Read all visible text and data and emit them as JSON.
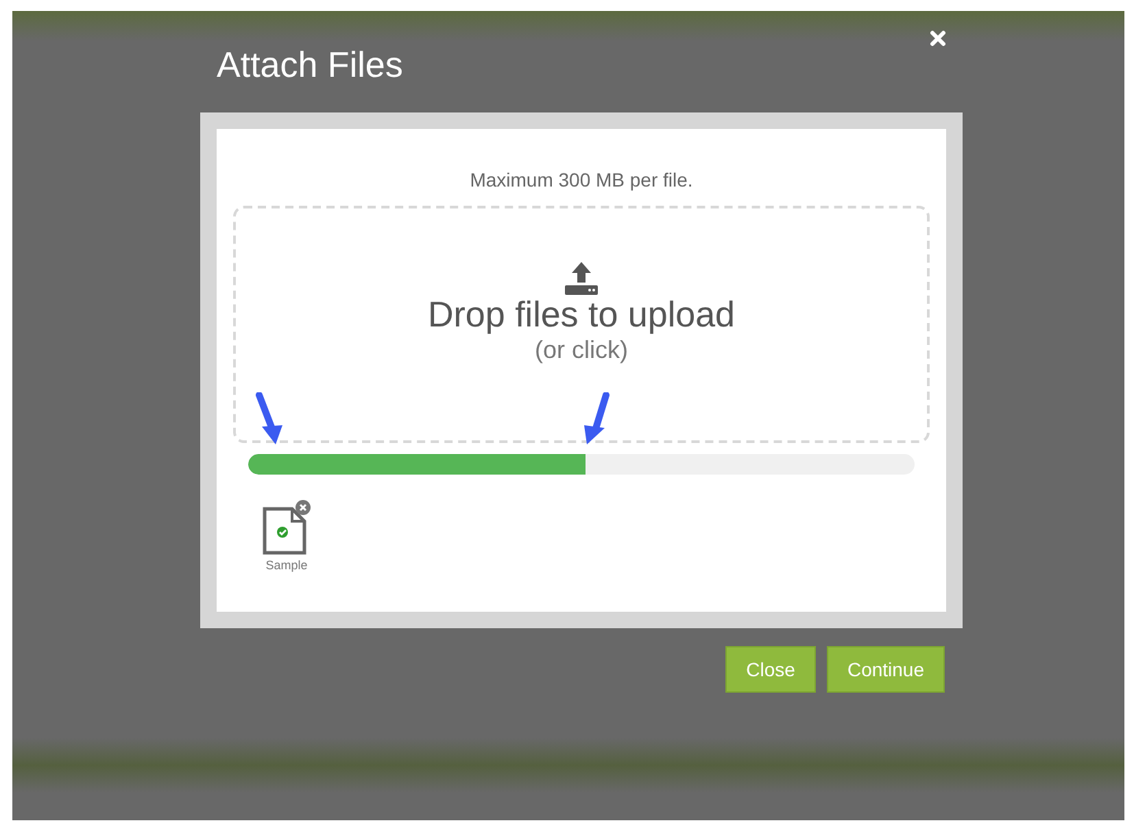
{
  "dialog": {
    "title": "Attach Files"
  },
  "upload": {
    "limit_note": "Maximum 300 MB per file.",
    "drop_label": "Drop files to upload",
    "drop_hint": "(or click)",
    "progress": {
      "level": 0.507
    }
  },
  "files": [
    {
      "name": "Sample",
      "complete": true
    }
  ],
  "buttons": [
    {
      "label": "Close"
    },
    {
      "label": "Continue"
    }
  ]
}
